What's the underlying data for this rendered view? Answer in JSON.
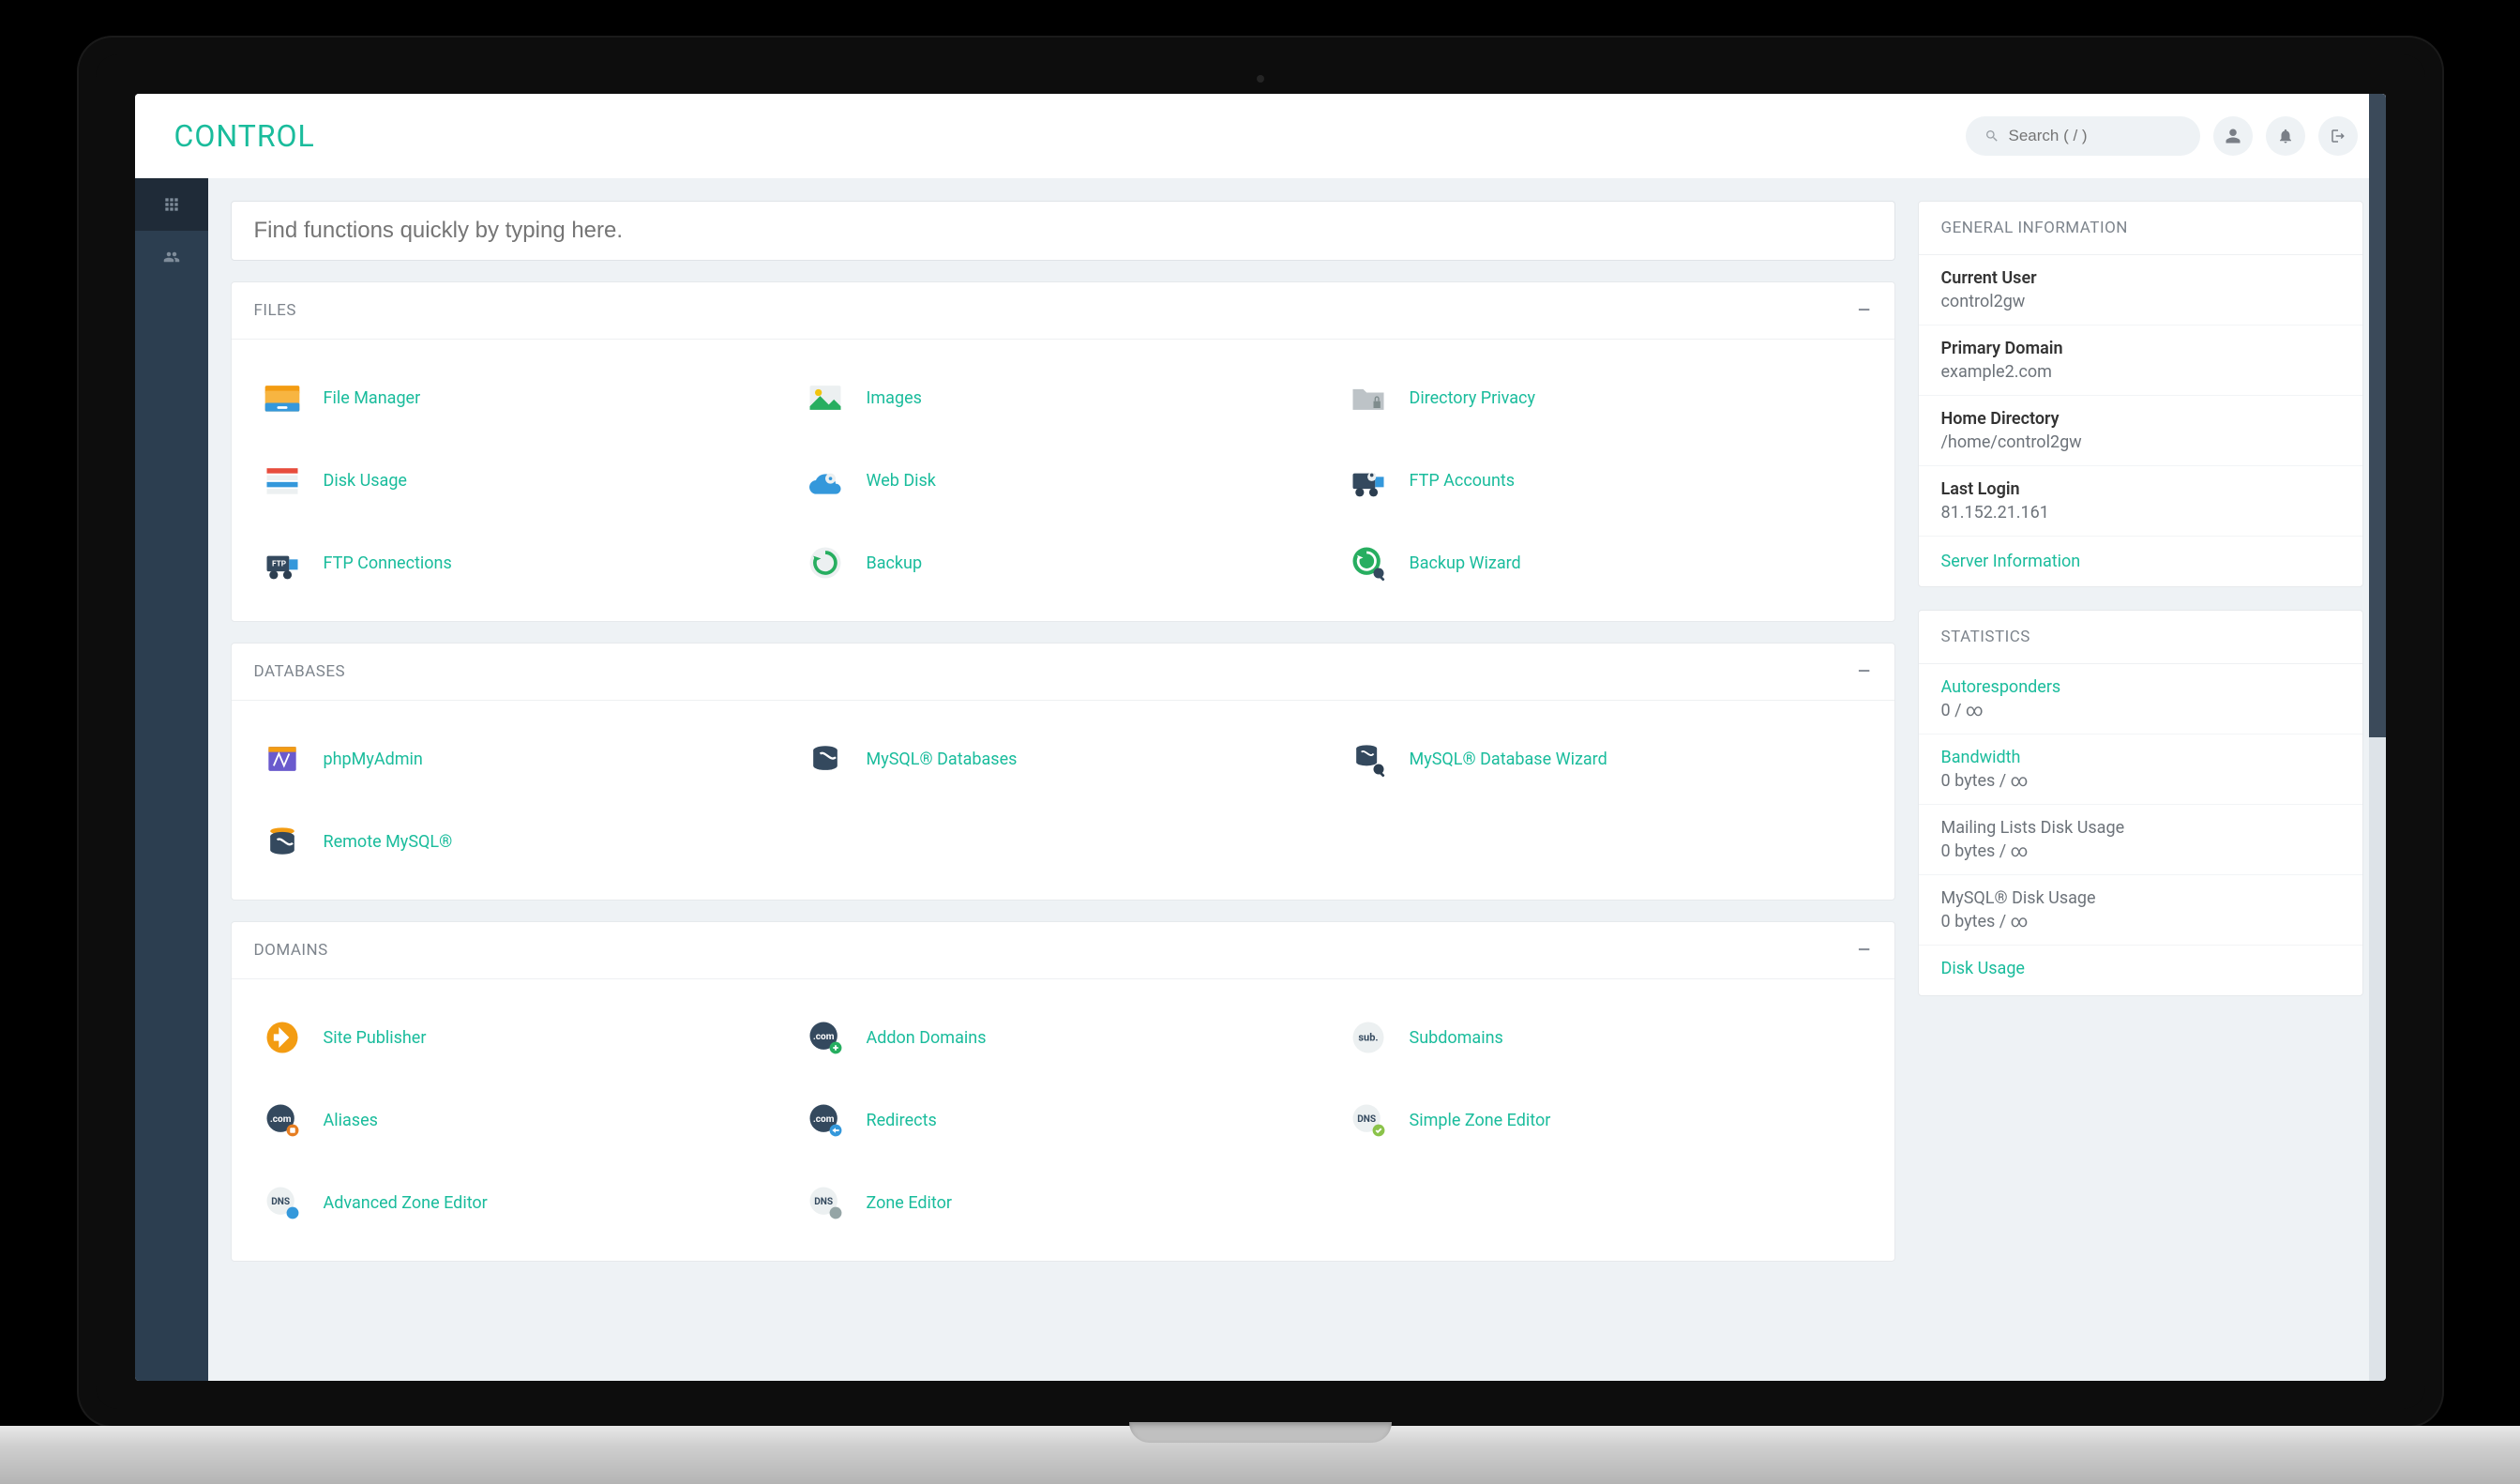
{
  "brand": "CONTROL",
  "search": {
    "placeholder": "Search ( / )"
  },
  "quick_search": {
    "placeholder": "Find functions quickly by typing here."
  },
  "sections": {
    "files": {
      "title": "FILES",
      "items": [
        {
          "label": "File Manager",
          "icon": "file-manager"
        },
        {
          "label": "Images",
          "icon": "images"
        },
        {
          "label": "Directory Privacy",
          "icon": "directory-privacy"
        },
        {
          "label": "Disk Usage",
          "icon": "disk-usage"
        },
        {
          "label": "Web Disk",
          "icon": "web-disk"
        },
        {
          "label": "FTP Accounts",
          "icon": "ftp-accounts"
        },
        {
          "label": "FTP Connections",
          "icon": "ftp-connections"
        },
        {
          "label": "Backup",
          "icon": "backup"
        },
        {
          "label": "Backup Wizard",
          "icon": "backup-wizard"
        }
      ]
    },
    "databases": {
      "title": "DATABASES",
      "items": [
        {
          "label": "phpMyAdmin",
          "icon": "phpmyadmin"
        },
        {
          "label": "MySQL® Databases",
          "icon": "mysql"
        },
        {
          "label": "MySQL® Database Wizard",
          "icon": "mysql-wizard"
        },
        {
          "label": "Remote MySQL®",
          "icon": "remote-mysql"
        }
      ]
    },
    "domains": {
      "title": "DOMAINS",
      "items": [
        {
          "label": "Site Publisher",
          "icon": "site-publisher"
        },
        {
          "label": "Addon Domains",
          "icon": "addon-domains"
        },
        {
          "label": "Subdomains",
          "icon": "subdomains"
        },
        {
          "label": "Aliases",
          "icon": "aliases"
        },
        {
          "label": "Redirects",
          "icon": "redirects"
        },
        {
          "label": "Simple Zone Editor",
          "icon": "simple-zone"
        },
        {
          "label": "Advanced Zone Editor",
          "icon": "advanced-zone"
        },
        {
          "label": "Zone Editor",
          "icon": "zone-editor"
        }
      ]
    }
  },
  "general_info": {
    "title": "GENERAL INFORMATION",
    "current_user_label": "Current User",
    "current_user": "control2gw",
    "primary_domain_label": "Primary Domain",
    "primary_domain": "example2.com",
    "home_dir_label": "Home Directory",
    "home_dir": "/home/control2gw",
    "last_login_label": "Last Login",
    "last_login": "81.152.21.161",
    "server_info": "Server Information"
  },
  "statistics": {
    "title": "STATISTICS",
    "autoresponders_label": "Autoresponders",
    "autoresponders_value": "0 / ∞",
    "bandwidth_label": "Bandwidth",
    "bandwidth_value": "0 bytes / ∞",
    "mailing_label": "Mailing Lists Disk Usage",
    "mailing_value": "0 bytes / ∞",
    "mysql_label": "MySQL® Disk Usage",
    "mysql_value": "0 bytes / ∞",
    "disk_usage_label": "Disk Usage"
  }
}
